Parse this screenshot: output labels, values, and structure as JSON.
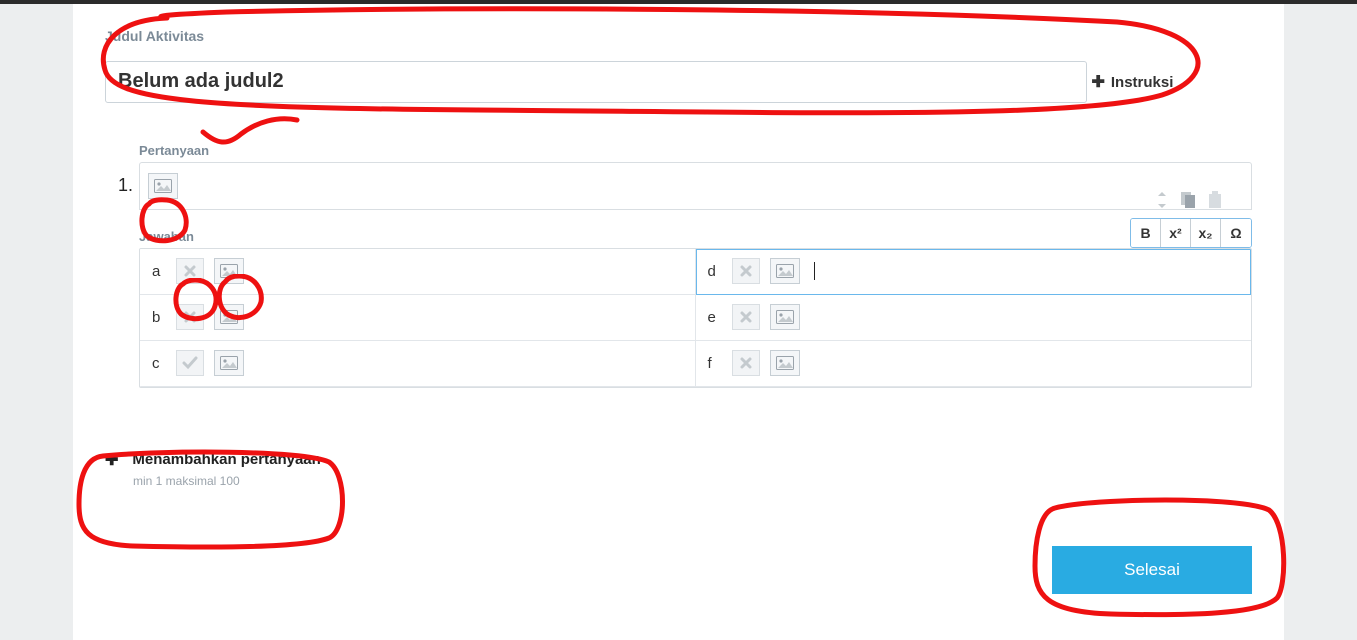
{
  "labels": {
    "activity_title": "Judul Aktivitas",
    "instruksi": "Instruksi",
    "pertanyaan": "Pertanyaan",
    "jawaban": "Jawaban",
    "add_question": "Menambahkan pertanyaan",
    "add_question_sub": "min 1   maksimal 100",
    "done": "Selesai"
  },
  "title_value": "Belum ada judul2",
  "question_number": "1.",
  "answers": [
    {
      "letter": "a",
      "checked": false,
      "active": false
    },
    {
      "letter": "d",
      "checked": false,
      "active": true
    },
    {
      "letter": "b",
      "checked": false,
      "active": false
    },
    {
      "letter": "e",
      "checked": false,
      "active": false
    },
    {
      "letter": "c",
      "checked": true,
      "active": false
    },
    {
      "letter": "f",
      "checked": false,
      "active": false
    }
  ],
  "format_toolbar": {
    "bold": "B",
    "sup": "x²",
    "sub": "x₂",
    "omega": "Ω"
  }
}
